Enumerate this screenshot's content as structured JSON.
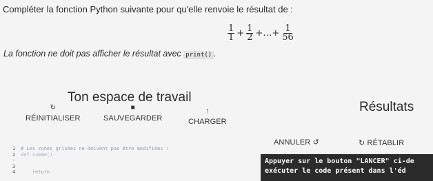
{
  "instruction": "Compléter la fonction Python suivante pour qu'elle renvoie le résultat de :",
  "formula": {
    "term1_num": "1",
    "term1_den": "1",
    "plus1": "+",
    "term2_num": "1",
    "term2_den": "2",
    "ellipsis": "+…+",
    "term3_num": "1",
    "term3_den": "56"
  },
  "note": {
    "text": "La fonction ne doit pas afficher le résultat avec",
    "code": "print()",
    "suffix": "."
  },
  "workspace": {
    "title": "Ton espace de travail"
  },
  "results": {
    "title": "Résultats"
  },
  "toolbar": {
    "reset_label": "RÉINITIALISER",
    "reset_icon": "refresh-icon",
    "save_label": "SAUVEGARDER",
    "save_icon": "floppy-icon",
    "load_label": "CHARGER",
    "load_icon": "upload-arrow-icon",
    "undo_label": "ANNULER",
    "undo_icon": "undo-icon",
    "redo_label": "RÉTABLIR",
    "redo_icon": "redo-icon"
  },
  "editor": {
    "lines": [
      {
        "num": "1",
        "code": "# Les zones grisées ne doivent pas être modifiées !"
      },
      {
        "num": "2 -",
        "code": "def somme():"
      },
      {
        "num": "3",
        "code": ""
      },
      {
        "num": "4",
        "code": "    return"
      }
    ]
  },
  "output": {
    "line1": "Appuyer sur le bouton \"LANCER\" ci-de",
    "line2": "exécuter le code présent dans l'éd"
  }
}
